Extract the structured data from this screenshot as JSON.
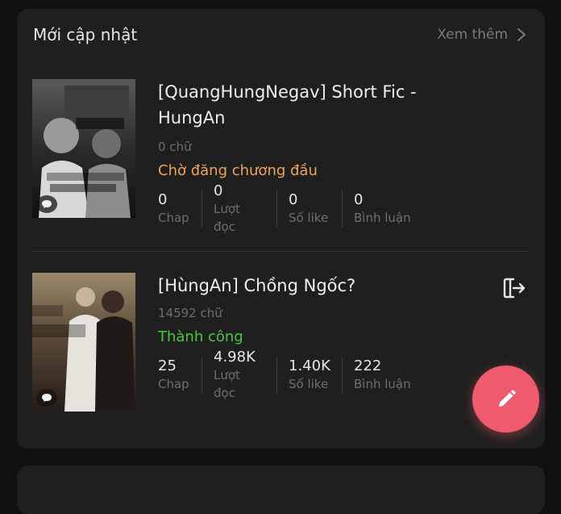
{
  "section": {
    "title": "Mới cập nhật",
    "see_more": "Xem thêm"
  },
  "stories": [
    {
      "title": "[QuangHungNegav] Short Fic - HungAn",
      "words": "0 chữ",
      "status": "Chờ đăng chương đầu",
      "status_color": "#f0a35a",
      "stats": [
        {
          "value": "0",
          "label": "Chap"
        },
        {
          "value": "0",
          "label": "Lượt đọc"
        },
        {
          "value": "0",
          "label": "Số like"
        },
        {
          "value": "0",
          "label": "Bình luận"
        }
      ]
    },
    {
      "title": "[HùngAn] Chồng Ngốc?",
      "words": "14592 chữ",
      "status": "Thành công",
      "status_color": "#4cc640",
      "stats": [
        {
          "value": "25",
          "label": "Chap"
        },
        {
          "value": "4.98K",
          "label": "Lượt đọc"
        },
        {
          "value": "1.40K",
          "label": "Số like"
        },
        {
          "value": "222",
          "label": "Bình luận"
        }
      ]
    }
  ],
  "fab": {
    "icon": "pencil-icon",
    "color": "#ef5a6c"
  }
}
